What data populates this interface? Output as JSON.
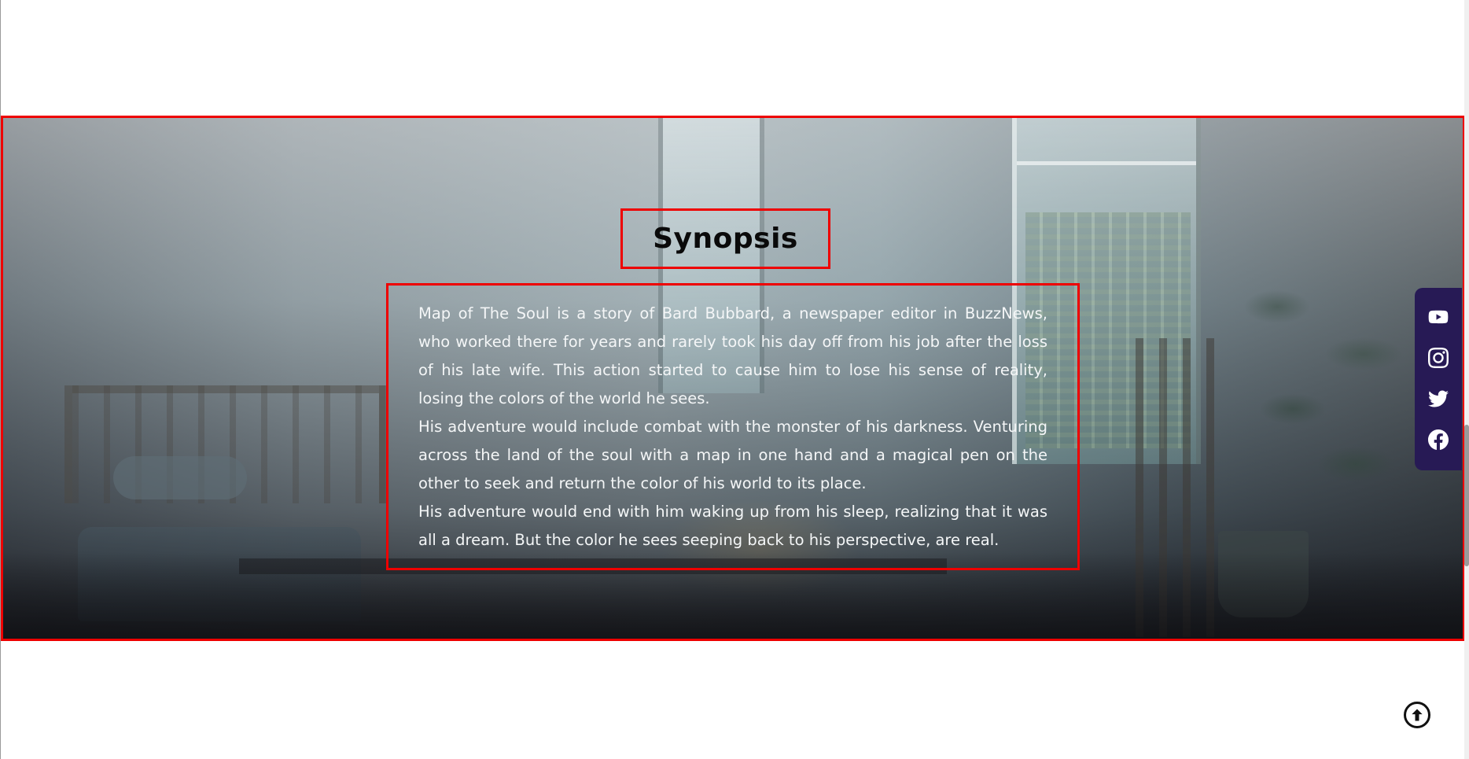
{
  "synopsis": {
    "title": "Synopsis",
    "paragraphs": [
      "Map of The Soul is a story of Bard Bubbard, a newspaper editor in BuzzNews, who worked there for years and rarely took his day off from his job after the loss of his late wife. This action started to cause him to lose his sense of reality, losing the colors of the world he sees.",
      "His adventure would include combat with the monster of his darkness. Venturing across the land of the soul with a map in one hand and a magical pen on the other to seek and return the color of his world to its place.",
      "His adventure would end with him waking up from his sleep, realizing that it was all a dream. But the color he sees seeping back to his perspective, are real."
    ]
  },
  "social": {
    "icons": [
      "youtube-icon",
      "instagram-icon",
      "twitter-icon",
      "facebook-icon"
    ],
    "background": "#271a55"
  },
  "colors": {
    "highlight_border": "#ee0000",
    "text_light": "#f4f6f7",
    "title": "#0a0a0a"
  },
  "back_to_top": {
    "icon": "arrow-up-circle-icon"
  }
}
